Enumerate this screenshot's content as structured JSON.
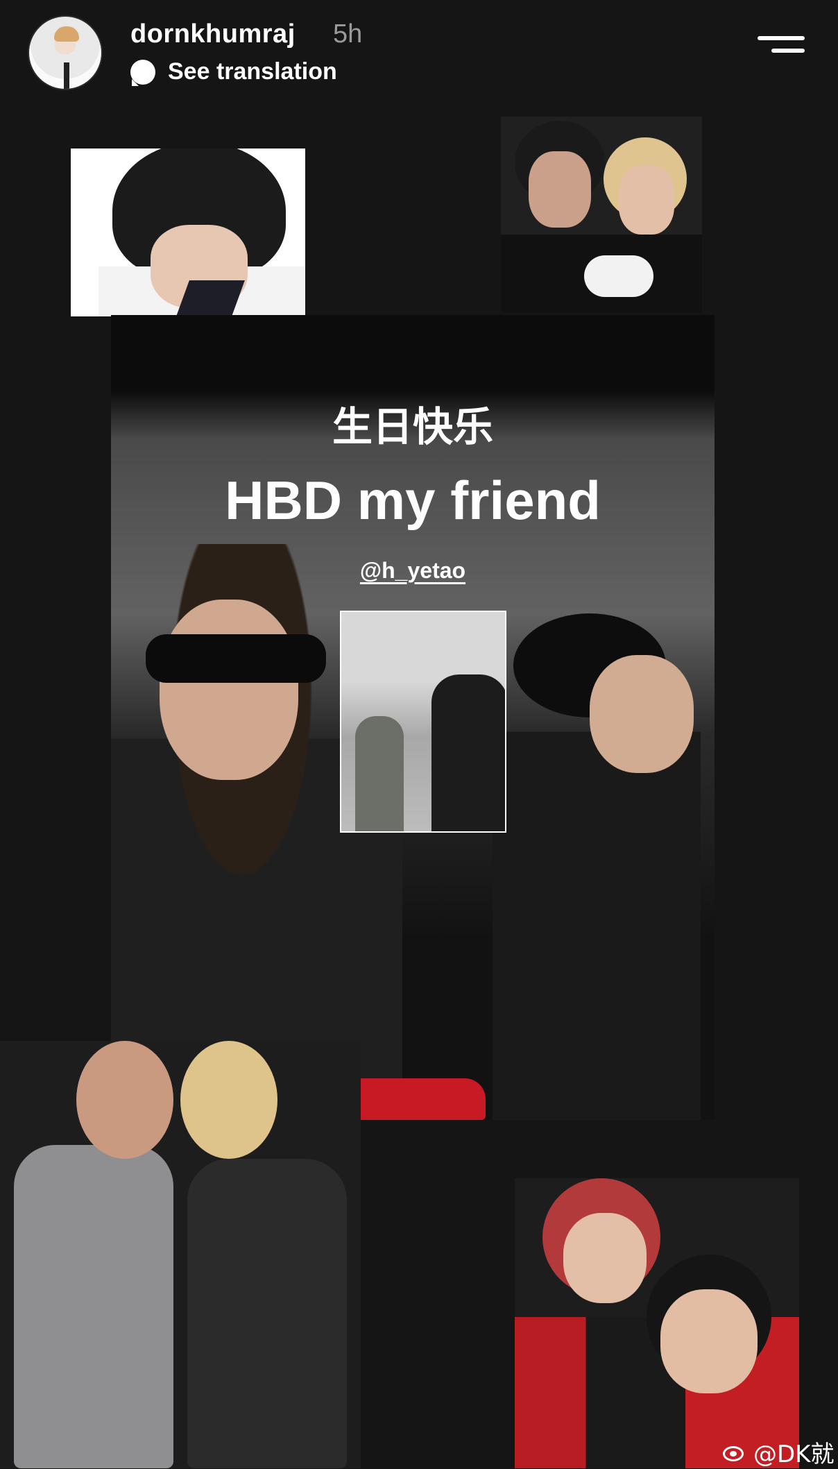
{
  "header": {
    "username": "dornkhumraj",
    "time": "5h",
    "translate_label": "See translation"
  },
  "story": {
    "greeting_cn": "生日快乐",
    "greeting_en": "HBD my friend",
    "mention": "@h_yetao"
  },
  "watermark": {
    "text": "@DK就"
  }
}
